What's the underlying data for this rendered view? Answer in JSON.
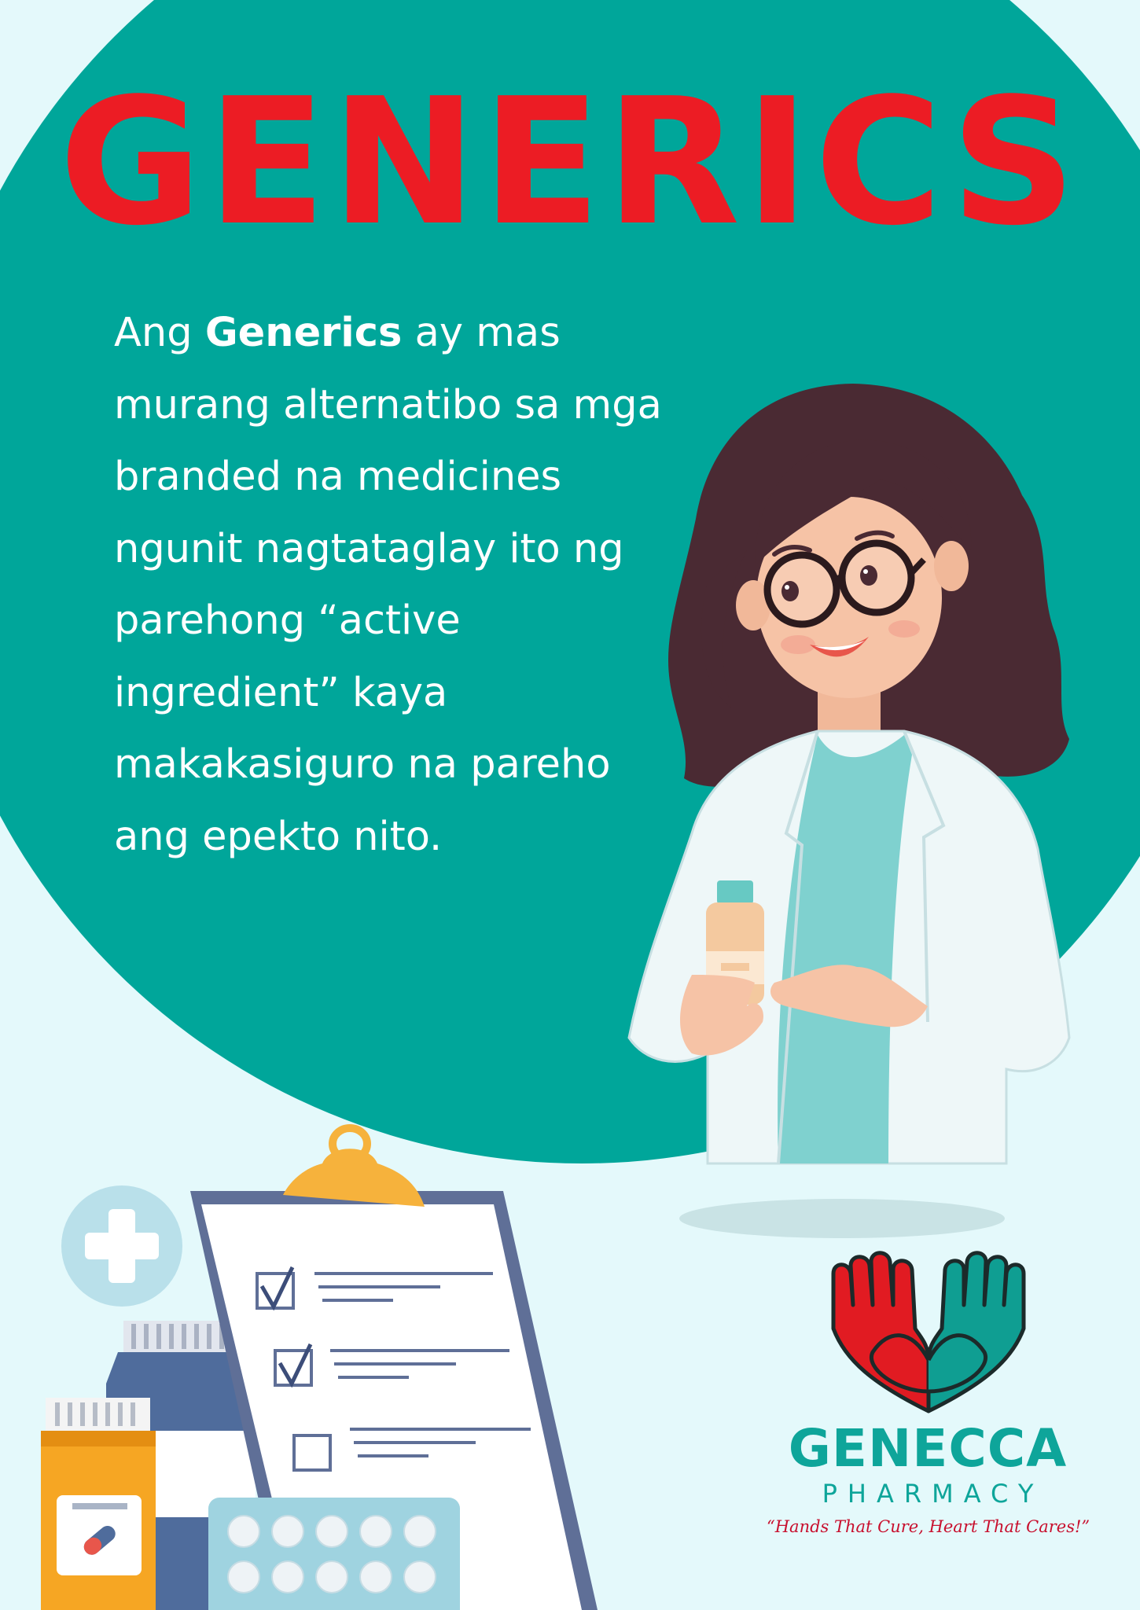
{
  "poster": {
    "title": "GENERICS",
    "body": {
      "line1_pre": "Ang",
      "line1_bold": "Generics",
      "line1_post": "ay mas",
      "line2": "murang alternatibo sa mga",
      "line3": "branded na medicines",
      "line4": "ngunit nagtataglay ito ng",
      "line5": "parehong “active",
      "line6": "ingredient” kaya",
      "line7": "makakasiguro na pareho",
      "line8": "ang epekto nito."
    }
  },
  "brand": {
    "name": "GENECCA",
    "subtitle": "PHARMACY",
    "tagline": "“Hands That Cure, Heart That Cares!”",
    "colors": {
      "red": "#e11b22",
      "teal": "#0f9e92",
      "outline": "#1c2a2a"
    }
  },
  "colors": {
    "background": "#e4f9fb",
    "teal_circle": "#00a69a",
    "title": "#ec1c24",
    "body_text": "#ffffff"
  },
  "illustrations": {
    "pharmacist": "pharmacist-illustration",
    "clipboard": "clipboard-checklist-icon",
    "medical_cross": "medical-cross-icon",
    "pill_bottle": "pill-bottle-icon",
    "medicine_jar": "medicine-jar-icon",
    "blister_pack": "blister-pack-icon"
  }
}
